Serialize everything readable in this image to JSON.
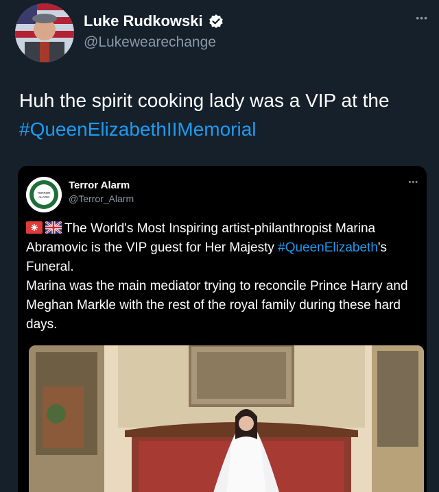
{
  "tweet": {
    "display_name": "Luke Rudkowski",
    "handle": "@Lukewearechange",
    "more_label": "•••",
    "text_plain": "Huh the spirit cooking lady was a VIP at the ",
    "hashtag": "#QueenElizabethIIMemorial"
  },
  "quote": {
    "display_name": "Terror Alarm",
    "handle": "@Terror_Alarm",
    "more_label": "•••",
    "avatar_text": "TERROR ALARM",
    "line1": "The World's Most Inspiring artist-philanthropist Marina Abramovic is the VIP guest for Her Majesty ",
    "hashtag": "#QueenElizabeth",
    "line1_end": "'s Funeral.",
    "line2": "Marina was the main mediator trying to reconcile Prince Harry and Meghan Markle with the rest of the royal family during these hard days."
  },
  "icons": [
    "verified-badge-icon",
    "more-options-icon",
    "flag-icon"
  ],
  "colors": {
    "background": "#15202b",
    "quote_background": "#000000",
    "link": "#1d9bf0",
    "secondary_text": "#8b98a5",
    "verified": "#1d9bf0"
  }
}
